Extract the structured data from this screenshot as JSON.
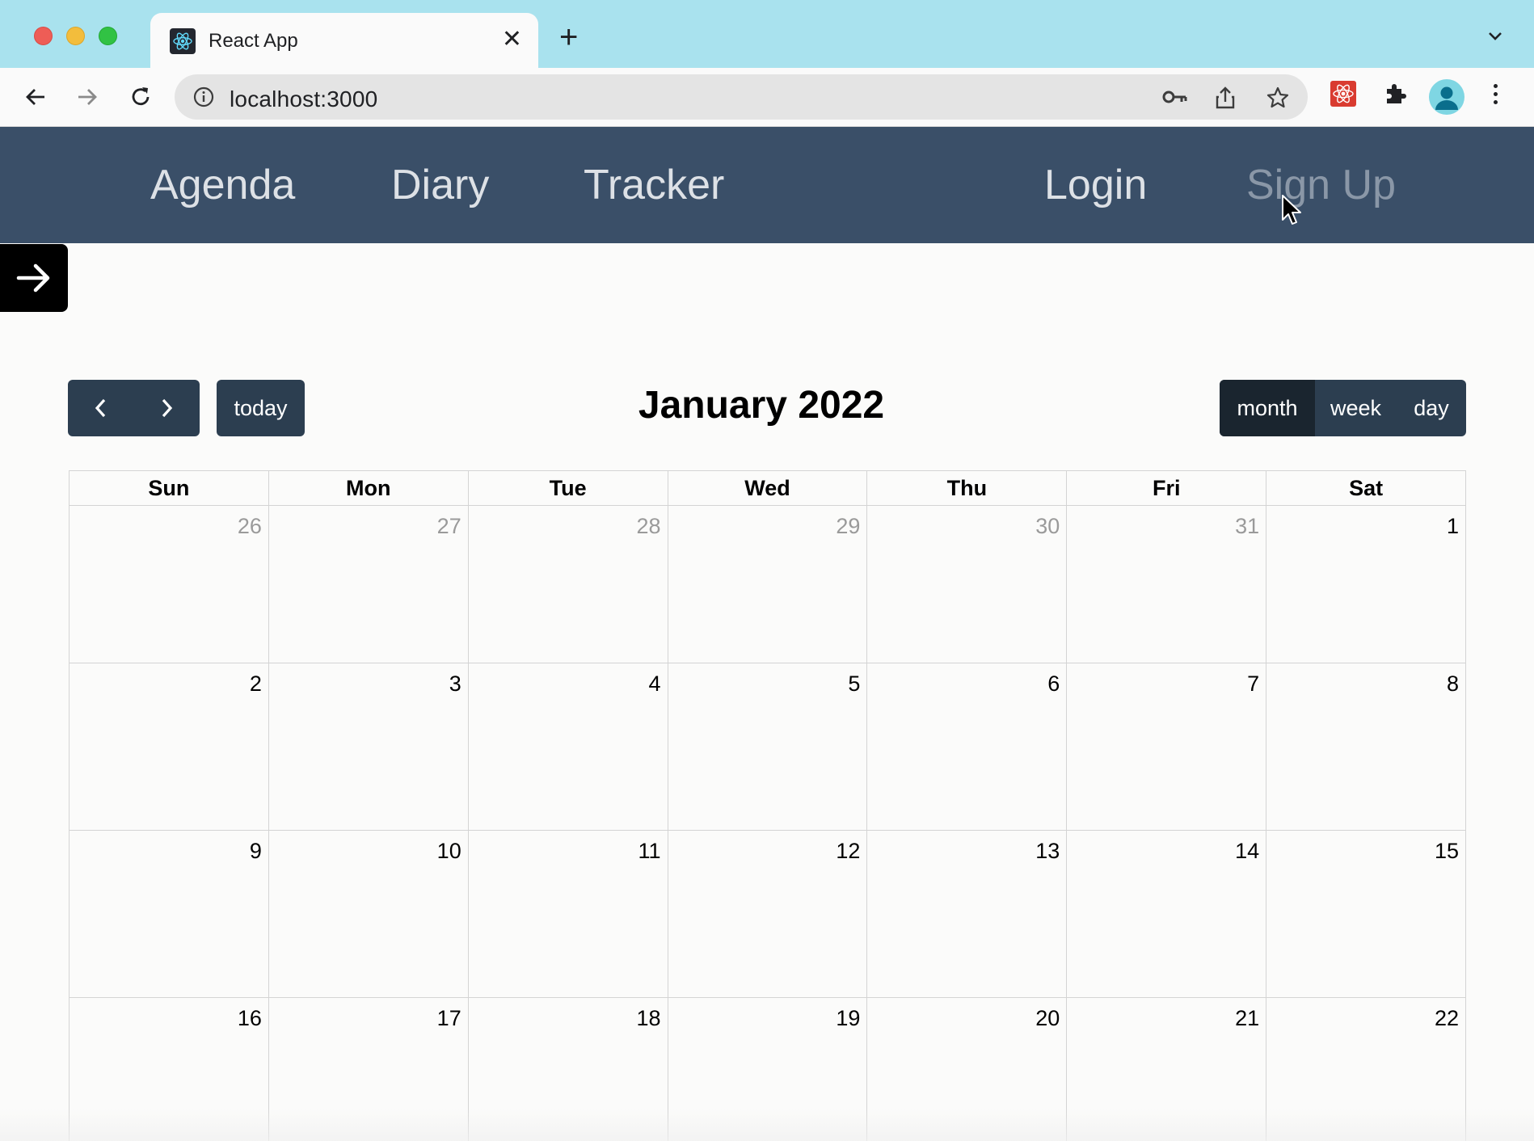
{
  "browser": {
    "tab_title": "React App",
    "tab_close": "✕",
    "new_tab": "+",
    "url": "localhost:3000"
  },
  "app_nav": {
    "left_links": [
      "Agenda",
      "Diary",
      "Tracker"
    ],
    "right_links": [
      "Login",
      "Sign Up"
    ]
  },
  "calendar": {
    "title": "January 2022",
    "today_label": "today",
    "views": [
      {
        "label": "month",
        "active": true
      },
      {
        "label": "week",
        "active": false
      },
      {
        "label": "day",
        "active": false
      }
    ],
    "weekdays": [
      "Sun",
      "Mon",
      "Tue",
      "Wed",
      "Thu",
      "Fri",
      "Sat"
    ],
    "weeks": [
      [
        "26",
        "27",
        "28",
        "29",
        "30",
        "31",
        "1"
      ],
      [
        "2",
        "3",
        "4",
        "5",
        "6",
        "7",
        "8"
      ],
      [
        "9",
        "10",
        "11",
        "12",
        "13",
        "14",
        "15"
      ],
      [
        "16",
        "17",
        "18",
        "19",
        "20",
        "21",
        "22"
      ]
    ],
    "other_month_days_first_week": 6
  },
  "colors": {
    "nav_bg": "#3a4f68",
    "button_bg": "#2c3e50",
    "button_active_bg": "#1a252f",
    "tabbar_bg": "#a9e2ee"
  }
}
